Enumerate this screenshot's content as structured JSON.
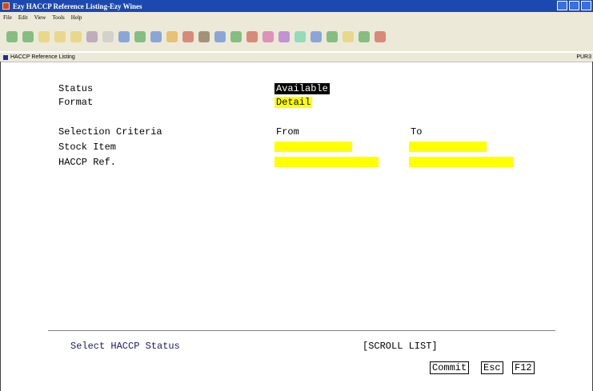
{
  "window": {
    "title": "Ezy HACCP Reference Listing-Ezy Wines"
  },
  "menubar": [
    "File",
    "Edit",
    "View",
    "Tools",
    "Help"
  ],
  "toolbar": {
    "colors": [
      "#2f9a3a",
      "#2f9a3a",
      "#e8c84a",
      "#e8c84a",
      "#e8c84a",
      "#9a7aa8",
      "#c0c0c0",
      "#3a6fd8",
      "#2f9a3a",
      "#3a6fd8",
      "#e8a020",
      "#c83a2a",
      "#6a4a2a",
      "#3a6fd8",
      "#2f9a3a",
      "#c83a2a",
      "#d04aa0",
      "#a04ad0",
      "#4ad0a0",
      "#3a6fd8",
      "#2f9a3a",
      "#e8c84a",
      "#2f9a3a",
      "#c83a2a"
    ]
  },
  "subwindow": {
    "title": "HACCP Reference Listing",
    "code": "PUR3"
  },
  "form": {
    "status_label": "Status",
    "status_value": "Available",
    "format_label": "Format",
    "format_value": "Detail",
    "selection_label": "Selection Criteria",
    "from_label": "From",
    "to_label": "To",
    "stock_item_label": "Stock Item",
    "haccp_ref_label": "HACCP Ref."
  },
  "footer": {
    "message": "Select HACCP Status",
    "mode": "[SCROLL LIST]",
    "commit": "Commit",
    "esc": "Esc",
    "f12": "F12"
  }
}
